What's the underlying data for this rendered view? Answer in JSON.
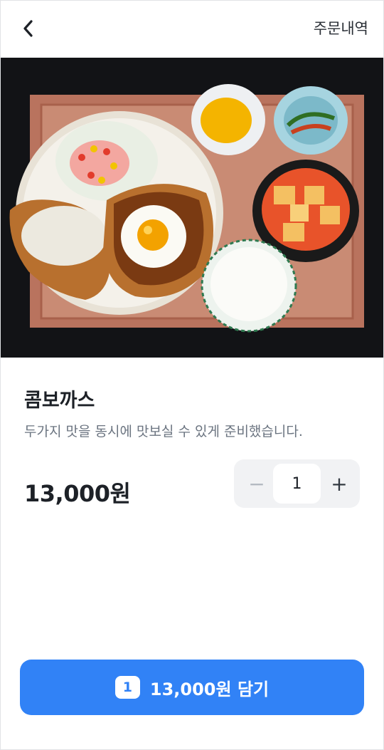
{
  "header": {
    "back_icon": "chevron-left-icon",
    "orders_label": "주문내역"
  },
  "product": {
    "image_subject": "combo-pork-cutlet-set-photo",
    "name": "콤보까스",
    "description": "두가지 맛을 동시에 맛보실 수 있게 준비했습니다.",
    "price": "13,000원"
  },
  "stepper": {
    "minus_symbol": "−",
    "quantity": "1",
    "plus_symbol": "+"
  },
  "cta": {
    "count": "1",
    "label": "13,000원 담기"
  },
  "colors": {
    "accent": "#3182f6",
    "text_primary": "#1d2127",
    "text_secondary": "#6b7480",
    "stepper_bg": "#f1f2f4"
  }
}
